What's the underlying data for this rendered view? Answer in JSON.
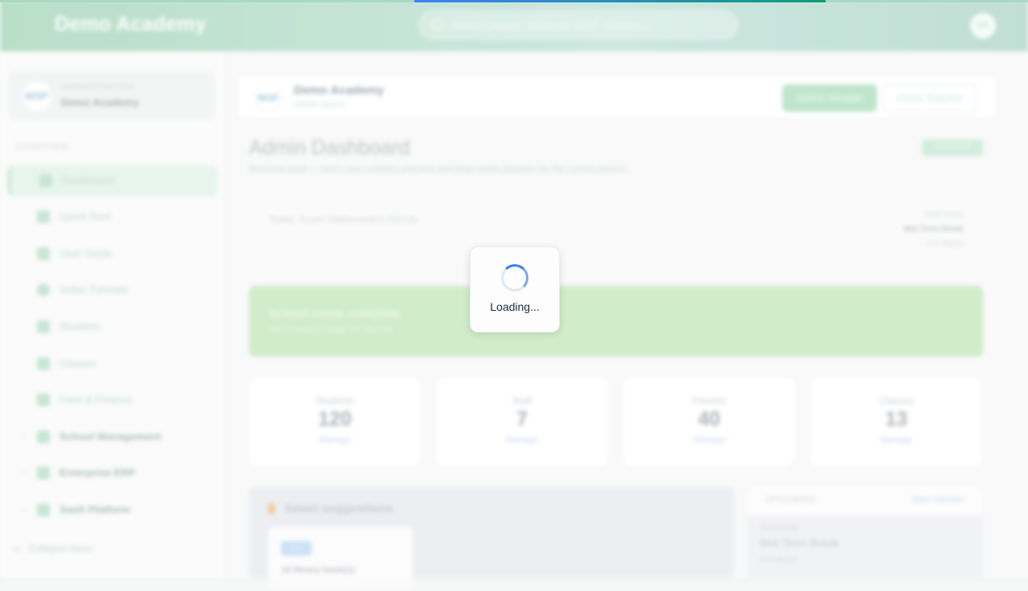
{
  "header": {
    "brand": "Demo Academy",
    "search_placeholder": "Search pages, students, staff, classes...",
    "avatar_initials": "DA"
  },
  "sidebar": {
    "school_kicker": "ADMINISTRATION",
    "school_name": "Demo Academy",
    "logo_text": "MSP",
    "section_label": "OVERVIEW",
    "items": [
      {
        "label": "Dashboard",
        "active": true
      },
      {
        "label": "Quick Start"
      },
      {
        "label": "User Guide"
      },
      {
        "label": "Video Tutorials"
      },
      {
        "label": "Students"
      },
      {
        "label": "Classes"
      },
      {
        "label": "Fees & Finance"
      },
      {
        "label": "School Management",
        "group": true
      },
      {
        "label": "Enterprise ERP",
        "group": true
      },
      {
        "label": "SaaS Platform",
        "group": true
      }
    ],
    "collapse_label": "Collapse menu"
  },
  "topbar": {
    "school_name": "Demo Academy",
    "subtitle": "Admin space",
    "primary_button": "Admin Module",
    "secondary_button": "Class Teacher"
  },
  "dashboard": {
    "title": "Admin Dashboard",
    "subtitle": "Welcome back — here's your school's overview and what needs attention for the current session.",
    "year_badge": "2024/2025",
    "exam_line": "Today: Exam: Mathematics (SS1A)",
    "next_label": "Next break",
    "next_title": "Mid-Term Break",
    "next_when": "in 5 day(s)",
    "setup_title": "School setup complete",
    "setup_sub": "Your school is ready for take-off."
  },
  "stats": [
    {
      "label": "Students",
      "value": "120",
      "link": "Manage"
    },
    {
      "label": "Staff",
      "value": "7",
      "link": "Manage"
    },
    {
      "label": "Parents",
      "value": "40",
      "link": "Manage"
    },
    {
      "label": "Classes",
      "value": "13",
      "link": "Manage"
    }
  ],
  "suggestions": {
    "title": "Smart suggestions",
    "tag": "Info",
    "item_text": "19 library book(s)"
  },
  "upcoming": {
    "label": "UPCOMING",
    "link": "Open calendar",
    "item_kicker": "Next break",
    "item_title": "Mid-Term Break",
    "item_when": "in 5 day(s)"
  },
  "loading": {
    "text": "Loading..."
  },
  "colors": {
    "accent": "#3b82f6",
    "brand_green": "#0f9d78",
    "banner_green": "#bfe5b5"
  }
}
